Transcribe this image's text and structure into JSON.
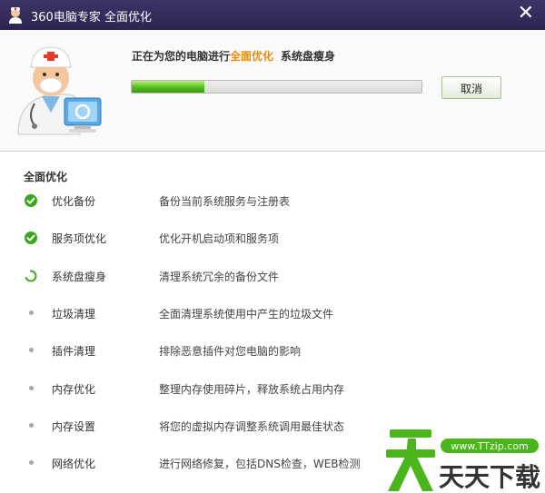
{
  "window": {
    "app_name": "360电脑专家",
    "title": "全面优化"
  },
  "status": {
    "prefix": "正在为您的电脑进行",
    "highlight": "全面优化",
    "current_task": "系统盘瘦身",
    "progress": 0.25,
    "cancel_label": "取消"
  },
  "section": {
    "title": "全面优化"
  },
  "items": [
    {
      "name": "优化备份",
      "desc": "备份当前系统服务与注册表",
      "state": "done"
    },
    {
      "name": "服务项优化",
      "desc": "优化开机启动项和服务项",
      "state": "done"
    },
    {
      "name": "系统盘瘦身",
      "desc": "清理系统冗余的备份文件",
      "state": "running"
    },
    {
      "name": "垃圾清理",
      "desc": "全面清理系统使用中产生的垃圾文件",
      "state": "pending"
    },
    {
      "name": "插件清理",
      "desc": "排除恶意插件对您电脑的影响",
      "state": "pending"
    },
    {
      "name": "内存优化",
      "desc": "整理内存使用碎片，释放系统占用内存",
      "state": "pending"
    },
    {
      "name": "内存设置",
      "desc": "将您的虚拟内存调整系统调用最佳状态",
      "state": "pending"
    },
    {
      "name": "网络优化",
      "desc": "进行网络修复，包括DNS检查，WEB检测",
      "state": "pending"
    }
  ],
  "watermark": {
    "url": "www.TTzip.com",
    "brand": "天天下载"
  },
  "colors": {
    "titlebar": "#2e2654",
    "highlight": "#f08a00",
    "done_green": "#3aa61c"
  }
}
